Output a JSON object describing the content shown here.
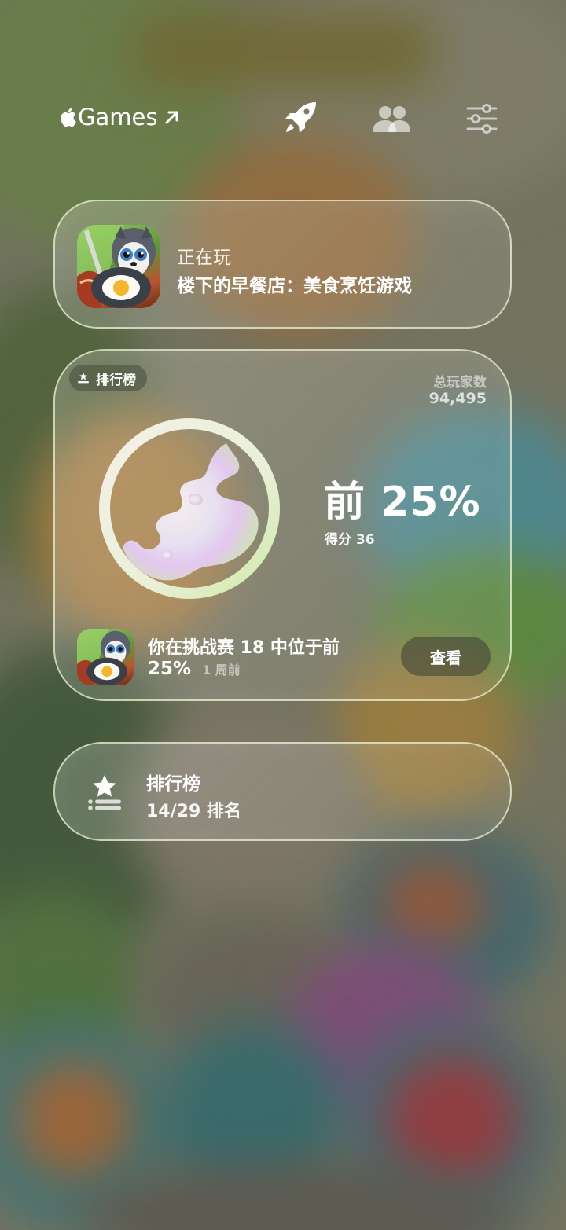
{
  "header": {
    "brand": "Games",
    "icons": [
      "apple-logo",
      "arrow-up-right",
      "rocket",
      "friends",
      "sliders"
    ]
  },
  "now_playing": {
    "label": "正在玩",
    "game_title": "楼下的早餐店：美食烹饪游戏"
  },
  "leaderboard_card": {
    "badge": "排行榜",
    "total_players_label": "总玩家数",
    "total_players": "94,495",
    "percentile": "前 25%",
    "percentile_fraction": 0.25,
    "score": "得分 36",
    "achievement_line1": "你在挑战赛 18 中位于前",
    "achievement_line2": "25%",
    "achievement_time": "1 周前",
    "view_button": "查看"
  },
  "ranking_card": {
    "title": "排行榜",
    "value": "14/29 排名"
  },
  "colors": {
    "text": "#ffffff",
    "card_border": "#f0f5d7",
    "button_bg": "#3c3e34"
  }
}
